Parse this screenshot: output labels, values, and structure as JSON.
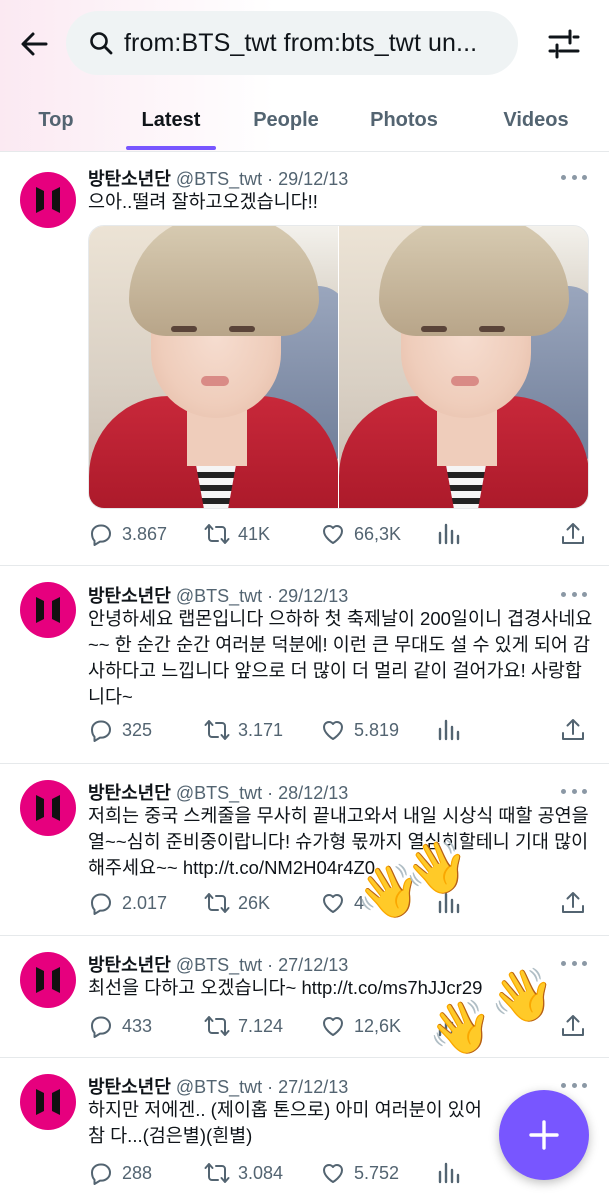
{
  "search": {
    "query": "from:BTS_twt from:bts_twt un..."
  },
  "tabs": [
    {
      "label": "Top"
    },
    {
      "label": "Latest",
      "active": true
    },
    {
      "label": "People"
    },
    {
      "label": "Photos"
    },
    {
      "label": "Videos"
    }
  ],
  "colors": {
    "accent": "#7856ff",
    "avatar": "#e6007e",
    "secondary_text": "#536471"
  },
  "tweets": [
    {
      "name": "방탄소년단",
      "handle": "@BTS_twt",
      "sep": "·",
      "date": "29/12/13",
      "text": "으아..떨려 잘하고오겠습니다!!",
      "has_media": true,
      "replies": "3.867",
      "retweets": "41K",
      "likes": "66,3K"
    },
    {
      "name": "방탄소년단",
      "handle": "@BTS_twt",
      "sep": "·",
      "date": "29/12/13",
      "text": "안녕하세요 랩몬입니다 으하하 첫 축제날이 200일이니 겹경사네요~~ 한 순간 순간 여러분 덕분에! 이런 큰 무대도 설 수 있게 되어 감사하다고 느낍니다 앞으로 더 많이 더 멀리 같이 걸어가요! 사랑합니다~",
      "replies": "325",
      "retweets": "3.171",
      "likes": "5.819"
    },
    {
      "name": "방탄소년단",
      "handle": "@BTS_twt",
      "sep": "·",
      "date": "28/12/13",
      "text": "저희는 중국 스케줄을 무사히 끝내고와서 내일 시상식 때할 공연을 열~~심히 준비중이랍니다! 슈가형 몫까지 열심히할테니 기대 많이 해주세요~~ http://t.co/NM2H04r4Z0",
      "replies": "2.017",
      "retweets": "26K",
      "likes": "4"
    },
    {
      "name": "방탄소년단",
      "handle": "@BTS_twt",
      "sep": "·",
      "date": "27/12/13",
      "text": "최선을 다하고 오겠습니다~ http://t.co/ms7hJJcr29",
      "replies": "433",
      "retweets": "7.124",
      "likes": "12,6K"
    },
    {
      "name": "방탄소년단",
      "handle": "@BTS_twt",
      "sep": "·",
      "date": "27/12/13",
      "text": "하지만 저에겐.. (제이홉 톤으로) 아미 여러분이 있어 참 다...(검은별)(흰별)",
      "replies": "288",
      "retweets": "3.084",
      "likes": "5.752"
    }
  ],
  "overlay_emoji": "👋"
}
